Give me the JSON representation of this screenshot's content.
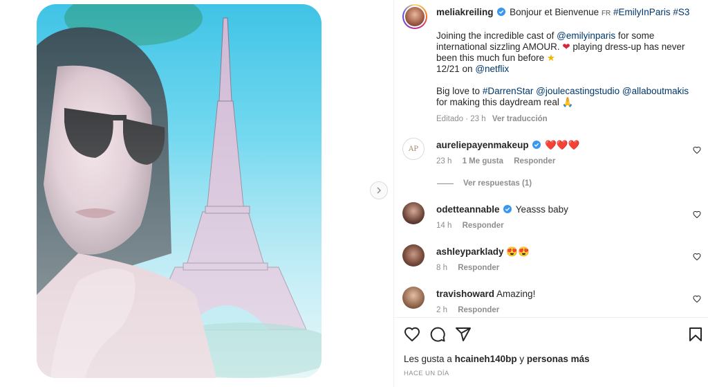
{
  "post": {
    "username": "meliakreiling",
    "caption_line1_pre": "Bonjour et Bienvenue",
    "flag": "FR",
    "hashtag1": "#EmilyInParis",
    "hashtag2": "#S3",
    "p2_pre": "Joining the incredible cast of",
    "mention_emily": "@emilyinparis",
    "p2_mid": "for some international sizzling AMOUR.",
    "p2_post": "playing dress-up has never been this much fun before",
    "date_on": "12/21 on",
    "mention_netflix": "@netflix",
    "p3_pre": "Big love to",
    "hashtag_darren": "#DarrenStar",
    "mention_joule": "@joulecastingstudio",
    "mention_makis": "@allaboutmakis",
    "p3_post": "for making this daydream real",
    "edited": "Editado · 23 h",
    "translate": "Ver traducción"
  },
  "comments": [
    {
      "username": "aureliepayenmakeup",
      "text": "❤️❤️❤️",
      "time": "23 h",
      "likes": "1 Me gusta",
      "reply": "Responder",
      "verified": true
    },
    {
      "username": "odetteannable",
      "text": "Yeasss baby",
      "time": "14 h",
      "reply": "Responder",
      "verified": true
    },
    {
      "username": "ashleyparklady",
      "text": "😍😍",
      "time": "8 h",
      "reply": "Responder",
      "verified": false
    },
    {
      "username": "travishoward",
      "text": "Amazing!",
      "time": "2 h",
      "reply": "Responder",
      "verified": false
    }
  ],
  "view_replies": "Ver respuestas (1)",
  "likes_line": {
    "pre": "Les gusta a",
    "user": "hcaineh140bp",
    "mid": "y",
    "post": "personas más"
  },
  "posted_ago": "HACE UN DÍA",
  "colors": {
    "link": "#00376b",
    "verified": "#3897f0",
    "meta": "#8e8e8e"
  },
  "icons": [
    "heart-icon",
    "comment-icon",
    "share-icon",
    "bookmark-icon",
    "chevron-right-icon",
    "verified-badge-icon"
  ]
}
